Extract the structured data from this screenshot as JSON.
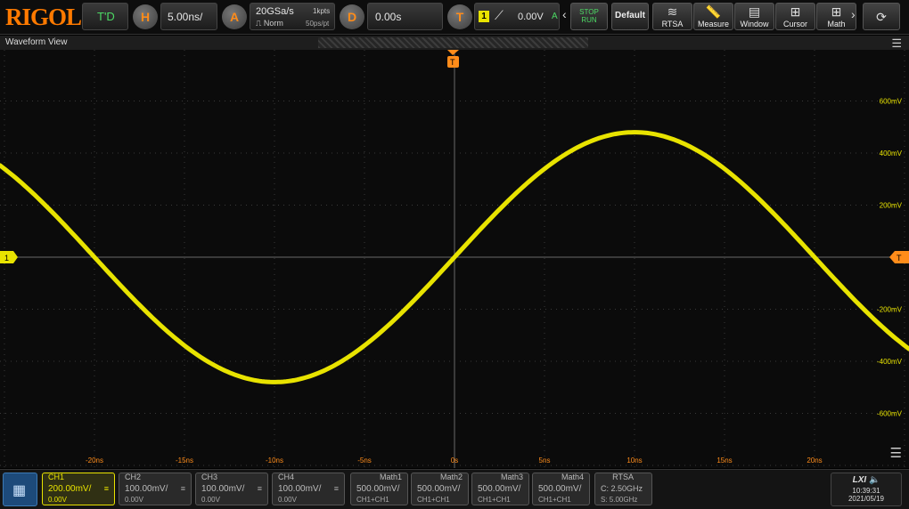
{
  "brand": "RIGOL",
  "topbar": {
    "td_label": "T'D",
    "horizontal": {
      "badge": "H",
      "value": "5.00ns/"
    },
    "acquire": {
      "badge": "A",
      "rate": "20GSa/s",
      "points": "1kpts",
      "mode": "Norm",
      "per_point": "50ps/pt"
    },
    "delay": {
      "badge": "D",
      "value": "0.00s"
    },
    "trigger": {
      "badge": "T",
      "source": "1",
      "level": "0.00V",
      "mode_letter": "A"
    },
    "stop_run": {
      "line1": "STOP",
      "line2": "RUN"
    },
    "default_label": "Default",
    "tools": [
      {
        "icon": "rtsa-icon",
        "label": "RTSA"
      },
      {
        "icon": "measure-icon",
        "label": "Measure"
      },
      {
        "icon": "window-icon",
        "label": "Window"
      },
      {
        "icon": "cursor-icon",
        "label": "Cursor"
      },
      {
        "icon": "math-icon",
        "label": "Math"
      }
    ]
  },
  "waveform_view": {
    "title": "Waveform View"
  },
  "screen": {
    "y_labels": [
      "600mV",
      "400mV",
      "200mV",
      "-200mV",
      "-400mV",
      "-600mV"
    ],
    "x_labels": [
      "-20ns",
      "-15ns",
      "-10ns",
      "-5ns",
      "0s",
      "5ns",
      "10ns",
      "15ns",
      "20ns"
    ],
    "ch1_marker": "1",
    "trigger_marker": "T",
    "trace_color": "#e8e300"
  },
  "channels": [
    {
      "name": "CH1",
      "scale": "200.00mV/",
      "offset": "0.00V"
    },
    {
      "name": "CH2",
      "scale": "100.00mV/",
      "offset": "0.00V"
    },
    {
      "name": "CH3",
      "scale": "100.00mV/",
      "offset": "0.00V"
    },
    {
      "name": "CH4",
      "scale": "100.00mV/",
      "offset": "0.00V"
    }
  ],
  "maths": [
    {
      "name": "Math1",
      "scale": "500.00mV/",
      "expr": "CH1+CH1"
    },
    {
      "name": "Math2",
      "scale": "500.00mV/",
      "expr": "CH1+CH1"
    },
    {
      "name": "Math3",
      "scale": "500.00mV/",
      "expr": "CH1+CH1"
    },
    {
      "name": "Math4",
      "scale": "500.00mV/",
      "expr": "CH1+CH1"
    }
  ],
  "rtsa": {
    "name": "RTSA",
    "center": "C: 2.50GHz",
    "span": "S: 5.00GHz"
  },
  "clock": {
    "time": "10:39:31",
    "date": "2021/05/19"
  }
}
